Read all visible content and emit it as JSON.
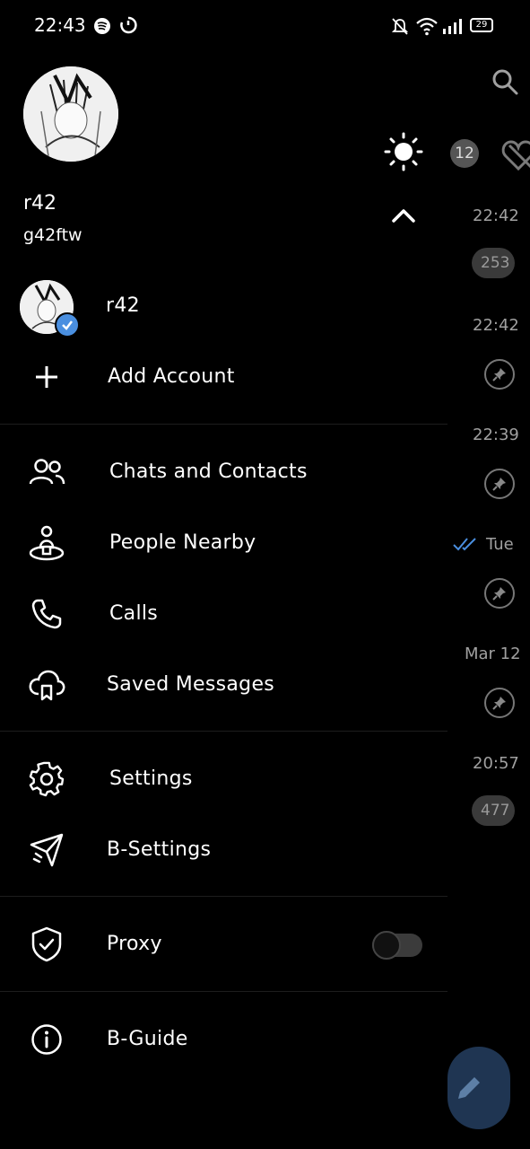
{
  "status_bar": {
    "time": "22:43",
    "battery": "29"
  },
  "profile": {
    "name": "r42",
    "username": "g42ftw"
  },
  "header": {
    "unread_count": "12"
  },
  "accounts": [
    {
      "name": "r42"
    }
  ],
  "add_account_label": "Add Account",
  "menu": {
    "chats_contacts": "Chats and Contacts",
    "people_nearby": "People Nearby",
    "calls": "Calls",
    "saved_messages": "Saved Messages",
    "settings": "Settings",
    "b_settings": "B-Settings",
    "proxy": "Proxy",
    "b_guide": "B-Guide"
  },
  "proxy_enabled": false,
  "background_chats": [
    {
      "time": "22:42",
      "badge": "253"
    },
    {
      "time": "22:42",
      "pinned": true
    },
    {
      "time": "22:39",
      "pinned": true
    },
    {
      "time": "Tue",
      "pinned": true
    },
    {
      "time": "Mar 12",
      "pinned": true
    },
    {
      "time": "20:57",
      "badge": "477"
    }
  ],
  "colors": {
    "accent": "#4a8fe0",
    "fab": "#1f3552",
    "read_ticks": "#4a8fe0"
  }
}
